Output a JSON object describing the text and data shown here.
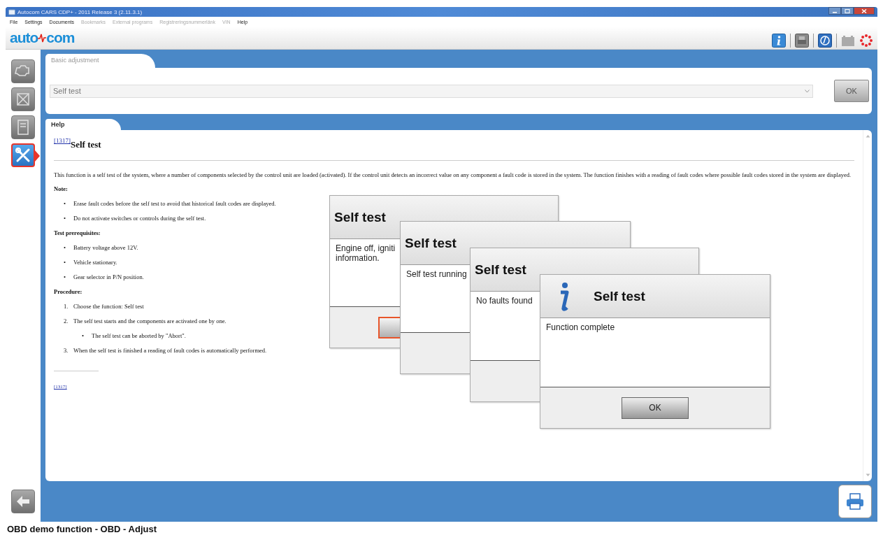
{
  "window": {
    "title": "Autocom CARS CDP+ - 2011 Release 3 (2.11.3.1)"
  },
  "menu": [
    {
      "label": "File",
      "disabled": false
    },
    {
      "label": "Settings",
      "disabled": false
    },
    {
      "label": "Documents",
      "disabled": false
    },
    {
      "label": "Bookmarks",
      "disabled": true
    },
    {
      "label": "External programs",
      "disabled": true
    },
    {
      "label": "Registreringsnummerlänk",
      "disabled": true
    },
    {
      "label": "VIN",
      "disabled": true
    },
    {
      "label": "Help",
      "disabled": false
    }
  ],
  "logo": {
    "left": "auto",
    "right": "com"
  },
  "sidebar": {
    "items": [
      {
        "kind": "engine",
        "selected": false
      },
      {
        "kind": "gearbox",
        "selected": false
      },
      {
        "kind": "document",
        "selected": false
      },
      {
        "kind": "tools",
        "selected": true
      }
    ]
  },
  "top_panel": {
    "tab": "Basic adjustment",
    "select": {
      "value": "Self test"
    },
    "ok_button": {
      "label": "OK",
      "disabled": true
    }
  },
  "help_panel": {
    "tab": "Help",
    "heading": {
      "ref": "[1317]",
      "title": "Self test"
    },
    "intro": "This function is a self test of the system, where a number of components selected by the control unit are loaded (activated). If the control unit detects an incorrect value on any component a fault code is stored in the system. The function finishes with a reading of fault codes where possible fault codes stored in the system are displayed.",
    "sections": [
      {
        "title": "Note:",
        "items": [
          {
            "marker": "•",
            "text": "Erase fault codes before the self test to avoid that historical fault codes are displayed."
          },
          {
            "marker": "•",
            "text": "Do not activate switches or controls during the self test."
          }
        ]
      },
      {
        "title": "Test prerequisites:",
        "items": [
          {
            "marker": "•",
            "text": "Battery voltage above 12V."
          },
          {
            "marker": "•",
            "text": "Vehicle stationary."
          },
          {
            "marker": "•",
            "text": "Gear selector in P/N position."
          }
        ]
      },
      {
        "title": "Procedure:",
        "items": [
          {
            "marker": "1.",
            "text": "Choose the function: Self test"
          },
          {
            "marker": "2.",
            "text": "The self test starts and the components are activated one by one.",
            "children": [
              {
                "marker": "•",
                "text": "The self test can be aborted by \"Abort\"."
              }
            ]
          },
          {
            "marker": "3.",
            "text": "When the self test is finished a reading of fault codes is automatically performed."
          }
        ]
      }
    ],
    "footnote": "[1317]"
  },
  "dialogs": [
    {
      "kind": "plain",
      "title": "Self test",
      "message_lines": [
        "Engine off, igniti",
        "information."
      ],
      "button": {
        "focused": true
      }
    },
    {
      "kind": "plain",
      "title": "Self test",
      "message_lines": [
        "Self test running"
      ]
    },
    {
      "kind": "plain",
      "title": "Self test",
      "message_lines": [
        "No faults found"
      ]
    },
    {
      "kind": "info",
      "title": "Self test",
      "message_lines": [
        "Function complete"
      ],
      "button": {
        "label": "OK",
        "focused": false
      }
    }
  ],
  "status_bar": {
    "text": "OBD demo function - OBD - Adjust"
  }
}
